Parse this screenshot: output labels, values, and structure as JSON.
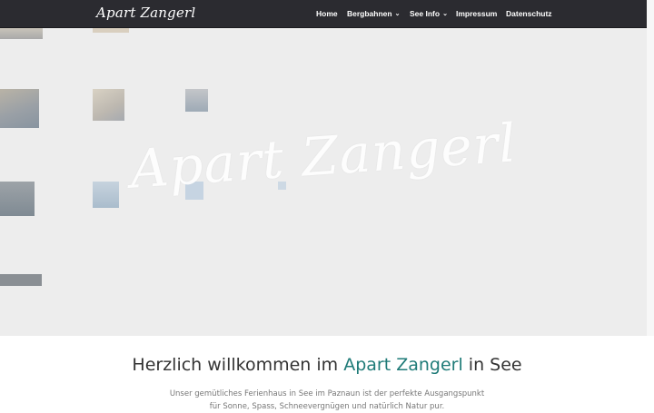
{
  "header": {
    "logo_text": "Apart Zangerl",
    "nav": [
      {
        "label": "Home"
      },
      {
        "label": "Bergbahnen",
        "dropdown": true,
        "icon": "chevron-down-icon"
      },
      {
        "label": "See Info",
        "dropdown": true,
        "icon": "chevron-down-icon"
      },
      {
        "label": "Impressum"
      },
      {
        "label": "Datenschutz"
      }
    ]
  },
  "hero": {
    "title": "Apart Zangerl"
  },
  "main": {
    "heading_prefix": "Herzlich willkommen im ",
    "heading_accent": "Apart Zangerl",
    "heading_suffix": " in See",
    "intro": "Unser gemütliches Ferienhaus in See im Paznaun ist der perfekte Ausgangspunkt für Sonne, Spass, Schneevergnügen und natürlich Natur pur."
  },
  "colors": {
    "header_bg": "#2b2b30",
    "hero_bg": "#ededed",
    "accent": "#1f7b78",
    "heading_text": "#333333",
    "body_text": "#777777"
  }
}
